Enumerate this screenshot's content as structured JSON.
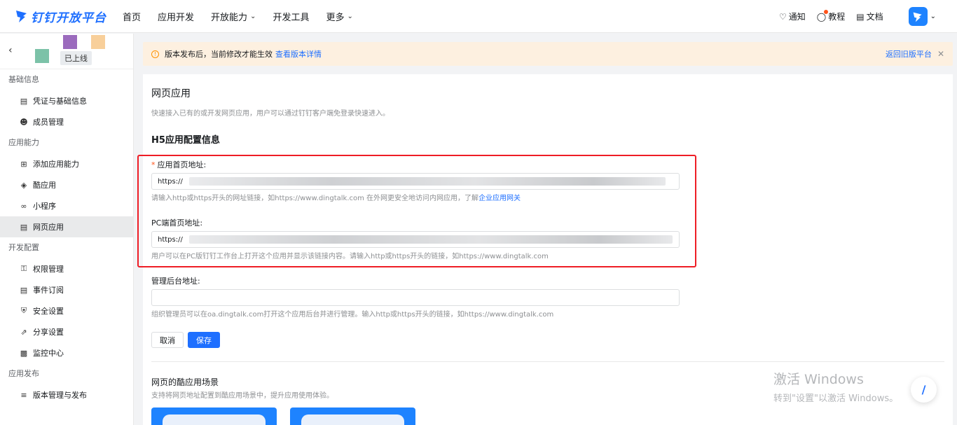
{
  "brand": {
    "name": "钉钉开放平台",
    "color": "#1e6fff"
  },
  "nav": {
    "items": [
      {
        "label": "首页",
        "dropdown": false
      },
      {
        "label": "应用开发",
        "dropdown": false
      },
      {
        "label": "开放能力",
        "dropdown": true
      },
      {
        "label": "开发工具",
        "dropdown": false
      },
      {
        "label": "更多",
        "dropdown": true
      }
    ],
    "tools": {
      "notify": "通知",
      "tutorial": "教程",
      "docs": "文档"
    }
  },
  "sidebar": {
    "status_tag": "已上线",
    "groups": [
      {
        "title": "基础信息",
        "items": [
          {
            "label": "凭证与基础信息",
            "icon": "credential-icon"
          },
          {
            "label": "成员管理",
            "icon": "user-icon"
          }
        ]
      },
      {
        "title": "应用能力",
        "items": [
          {
            "label": "添加应用能力",
            "icon": "grid-add-icon"
          },
          {
            "label": "酷应用",
            "icon": "cube-icon"
          },
          {
            "label": "小程序",
            "icon": "link-icon"
          },
          {
            "label": "网页应用",
            "icon": "browser-icon",
            "active": true
          }
        ]
      },
      {
        "title": "开发配置",
        "items": [
          {
            "label": "权限管理",
            "icon": "key-icon"
          },
          {
            "label": "事件订阅",
            "icon": "event-icon"
          },
          {
            "label": "安全设置",
            "icon": "shield-icon"
          },
          {
            "label": "分享设置",
            "icon": "share-icon"
          },
          {
            "label": "监控中心",
            "icon": "monitor-icon"
          }
        ]
      },
      {
        "title": "应用发布",
        "items": [
          {
            "label": "版本管理与发布",
            "icon": "layers-icon"
          }
        ]
      }
    ]
  },
  "banner": {
    "text": "版本发布后，当前修改才能生效",
    "link": "查看版本详情",
    "right_link": "返回旧版平台"
  },
  "main": {
    "title": "网页应用",
    "desc": "快速接入已有的或开发网页应用，用户可以通过钉钉客户端免登录快速进入。",
    "section": "H5应用配置信息",
    "fields": {
      "home": {
        "label": "应用首页地址:",
        "value": "https://",
        "help": "请输入http或https开头的网址链接，如https://www.dingtalk.com 在外网更安全地访问内网应用，了解",
        "help_link": "企业应用网关"
      },
      "pc": {
        "label": "PC端首页地址:",
        "value": "https://",
        "help": "用户可以在PC版钉钉工作台上打开这个应用并显示该链接内容。请输入http或https开头的链接，如https://www.dingtalk.com"
      },
      "admin": {
        "label": "管理后台地址:",
        "value": "",
        "help": "组织管理员可以在oa.dingtalk.com打开这个应用后台并进行管理。输入http或https开头的链接，如https://www.dingtalk.com"
      }
    },
    "buttons": {
      "cancel": "取消",
      "save": "保存"
    },
    "scene_title": "网页的酷应用场景",
    "scene_desc": "支持将网页地址配置到酷应用场景中，提升应用使用体验。"
  },
  "watermark": {
    "line1": "激活 Windows",
    "line2": "转到\"设置\"以激活 Windows。"
  }
}
